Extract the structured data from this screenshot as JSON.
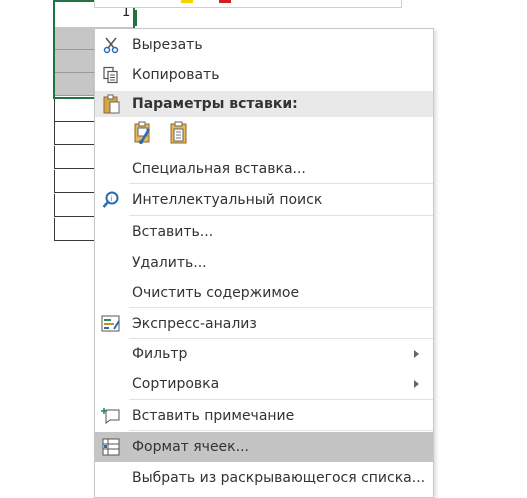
{
  "sheet": {
    "active_cell_value": "1"
  },
  "menu": {
    "cut": "Вырезать",
    "copy": "Копировать",
    "paste_options_header": "Параметры вставки:",
    "paste_special": "Специальная вставка...",
    "smart_lookup": "Интеллектуальный поиск",
    "insert": "Вставить...",
    "delete": "Удалить...",
    "clear_contents": "Очистить содержимое",
    "quick_analysis": "Экспресс-анализ",
    "filter": "Фильтр",
    "sort": "Сортировка",
    "insert_comment": "Вставить примечание",
    "format_cells": "Формат ячеек...",
    "pick_from_list": "Выбрать из раскрывающегося списка..."
  },
  "colors": {
    "selection_border": "#217346",
    "highlight": "#c4c4c4",
    "header_bg": "#e9e9e9",
    "icon_blue": "#2b6cb0",
    "icon_green": "#2e8b57",
    "icon_orange": "#d08a2a"
  }
}
